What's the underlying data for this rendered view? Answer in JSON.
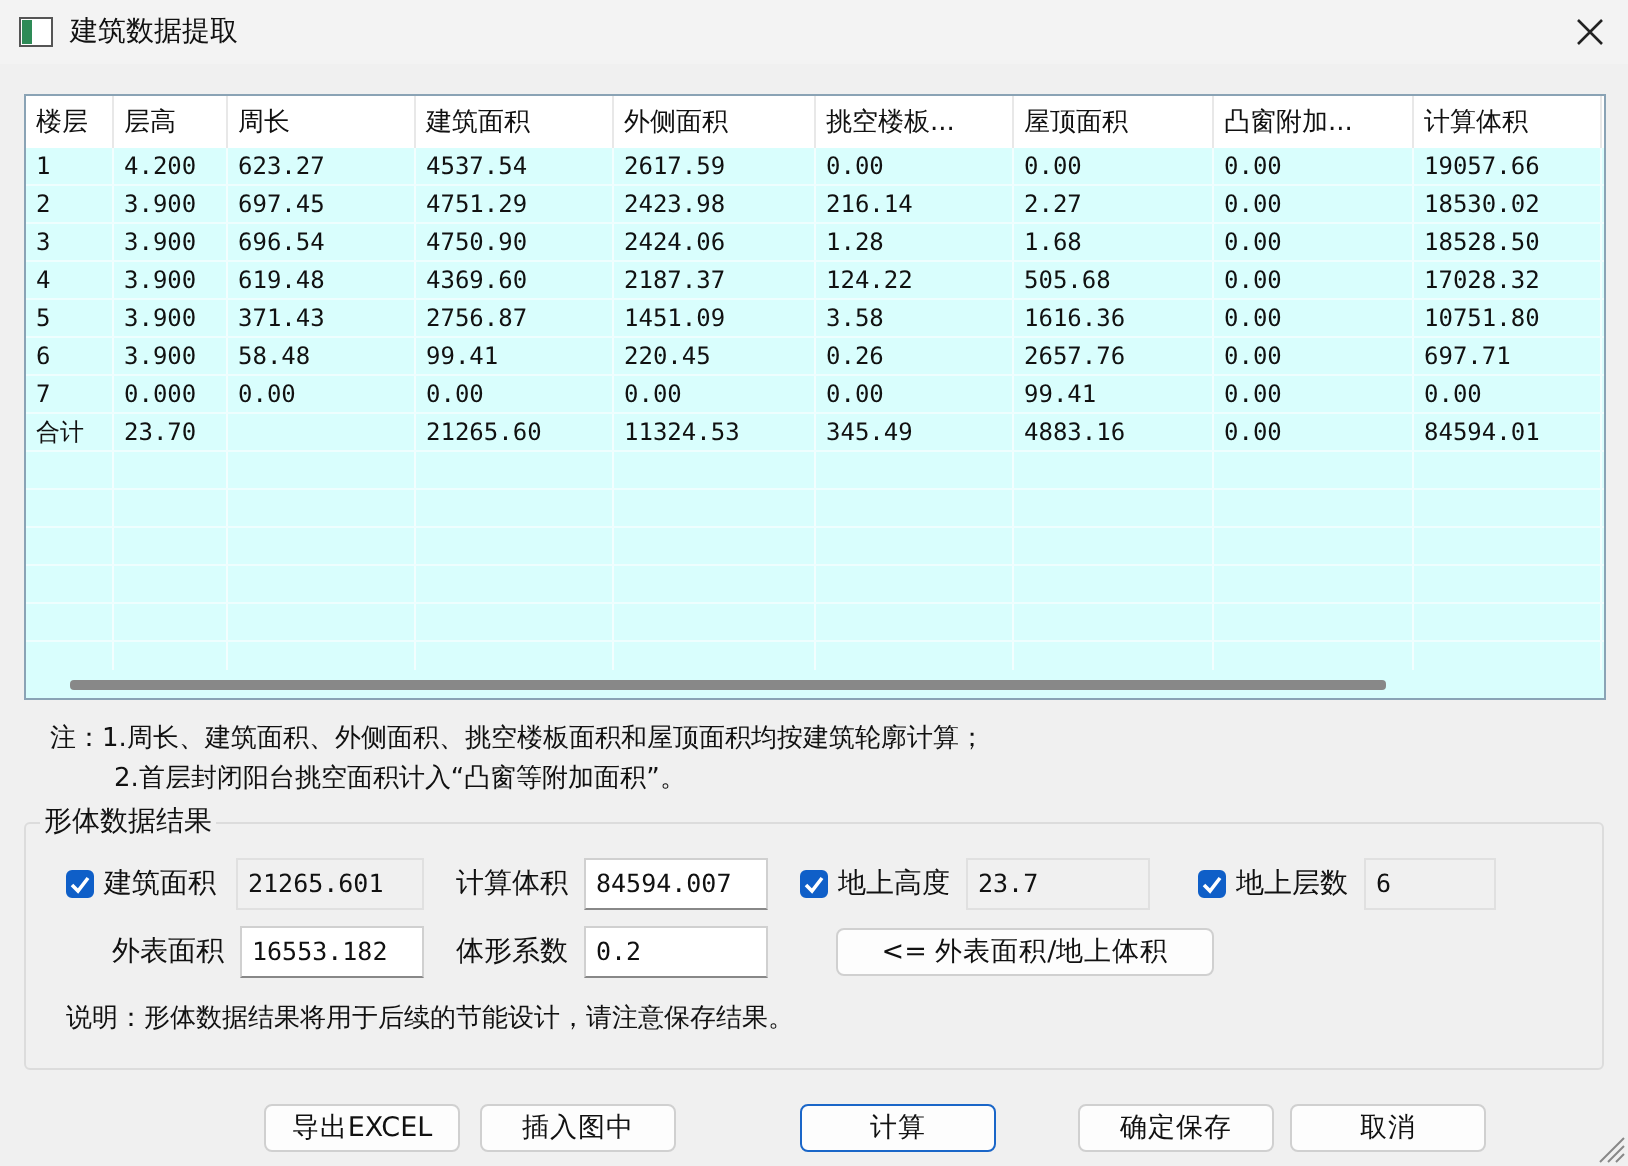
{
  "window": {
    "title": "建筑数据提取"
  },
  "table": {
    "columns": [
      "楼层",
      "层高",
      "周长",
      "建筑面积",
      "外侧面积",
      "挑空楼板...",
      "屋顶面积",
      "凸窗附加...",
      "计算体积"
    ],
    "rows": [
      [
        "1",
        "4.200",
        "623.27",
        "4537.54",
        "2617.59",
        "0.00",
        "0.00",
        "0.00",
        "19057.66"
      ],
      [
        "2",
        "3.900",
        "697.45",
        "4751.29",
        "2423.98",
        "216.14",
        "2.27",
        "0.00",
        "18530.02"
      ],
      [
        "3",
        "3.900",
        "696.54",
        "4750.90",
        "2424.06",
        "1.28",
        "1.68",
        "0.00",
        "18528.50"
      ],
      [
        "4",
        "3.900",
        "619.48",
        "4369.60",
        "2187.37",
        "124.22",
        "505.68",
        "0.00",
        "17028.32"
      ],
      [
        "5",
        "3.900",
        "371.43",
        "2756.87",
        "1451.09",
        "3.58",
        "1616.36",
        "0.00",
        "10751.80"
      ],
      [
        "6",
        "3.900",
        "58.48",
        "99.41",
        "220.45",
        "0.26",
        "2657.76",
        "0.00",
        "697.71"
      ],
      [
        "7",
        "0.000",
        "0.00",
        "0.00",
        "0.00",
        "0.00",
        "99.41",
        "0.00",
        "0.00"
      ],
      [
        "合计",
        "23.70",
        "",
        "21265.60",
        "11324.53",
        "345.49",
        "4883.16",
        "0.00",
        "84594.01"
      ]
    ]
  },
  "notes": [
    "注：1.周长、建筑面积、外侧面积、挑空楼板面积和屋顶面积均按建筑轮廓计算；",
    "2.首层封闭阳台挑空面积计入“凸窗等附加面积”。"
  ],
  "group": {
    "title": "形体数据结果",
    "fields": [
      {
        "kind": "check",
        "label": "建筑面积",
        "checked": true,
        "value": "21265.601",
        "readonly": true
      },
      {
        "kind": "plain",
        "label": "计算体积",
        "value": "84594.007",
        "readonly": false
      },
      {
        "kind": "check",
        "label": "地上高度",
        "checked": true,
        "value": "23.7",
        "readonly": true
      },
      {
        "kind": "check",
        "label": "地上层数",
        "checked": true,
        "value": "6",
        "readonly": true
      },
      {
        "kind": "plain",
        "label": "外表面积",
        "value": "16553.182",
        "readonly": false
      },
      {
        "kind": "plain",
        "label": "体形系数",
        "value": "0.2",
        "readonly": false
      },
      {
        "kind": "button",
        "label": "<= 外表面积/地上体积"
      }
    ],
    "explanation": "说明：形体数据结果将用于后续的节能设计，请注意保存结果。"
  },
  "buttons": [
    {
      "label": "导出EXCEL",
      "default": false
    },
    {
      "label": "插入图中",
      "default": false
    },
    {
      "label": "计算",
      "default": true
    },
    {
      "label": "确定保存",
      "default": false
    },
    {
      "label": "取消",
      "default": false
    }
  ]
}
